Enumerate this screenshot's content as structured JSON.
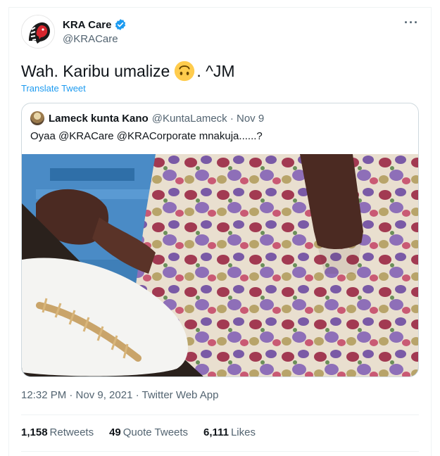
{
  "author": {
    "name": "KRA Care",
    "handle": "@KRACare"
  },
  "tweet": {
    "text_before_emoji": "Wah. Karibu umalize",
    "emoji": "upside-down-face",
    "text_after_emoji": ". ^JM",
    "translate_label": "Translate Tweet"
  },
  "quoted": {
    "name": "Lameck kunta Kano",
    "handle_and_date": "@KuntaLameck · Nov 9",
    "text": "Oyaa @KRACare @KRACorporate  mnakuja......?"
  },
  "meta": {
    "timestamp": "12:32 PM · Nov 9, 2021 · Twitter Web App"
  },
  "stats": {
    "retweets_count": "1,158",
    "retweets_label": "Retweets",
    "quotes_count": "49",
    "quotes_label": "Quote Tweets",
    "likes_count": "6,111",
    "likes_label": "Likes"
  },
  "colors": {
    "link_blue": "#1d9bf0",
    "secondary_text": "#536471",
    "verified_blue": "#1d9bf0"
  }
}
